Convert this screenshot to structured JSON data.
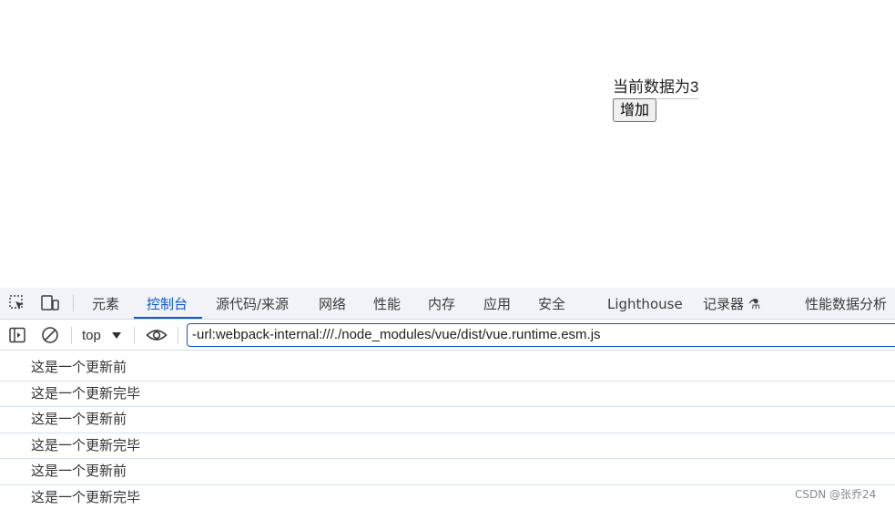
{
  "page": {
    "counter_text": "当前数据为3",
    "add_button_label": "增加"
  },
  "devtools": {
    "tabs": [
      {
        "label": "元素"
      },
      {
        "label": "控制台",
        "active": true
      },
      {
        "label": "源代码/来源"
      },
      {
        "label": "网络"
      },
      {
        "label": "性能"
      },
      {
        "label": "内存"
      },
      {
        "label": "应用"
      },
      {
        "label": "安全"
      },
      {
        "label": "Lighthouse"
      },
      {
        "label": "记录器 ⚗"
      },
      {
        "label": "性能数据分析"
      }
    ],
    "toolbar": {
      "context": "top",
      "filter_value": "-url:webpack-internal:///./node_modules/vue/dist/vue.runtime.esm.js"
    },
    "console_logs": [
      "这是一个更新前",
      "这是一个更新完毕",
      "这是一个更新前",
      "这是一个更新完毕",
      "这是一个更新前",
      "这是一个更新完毕"
    ],
    "accent_color": "#0b57d0",
    "icons": [
      "inspect-element-icon",
      "device-toggle-icon",
      "sidebar-toggle-icon",
      "clear-console-icon",
      "context-caret-icon",
      "live-expression-eye-icon"
    ]
  },
  "watermark": "CSDN @张乔24"
}
